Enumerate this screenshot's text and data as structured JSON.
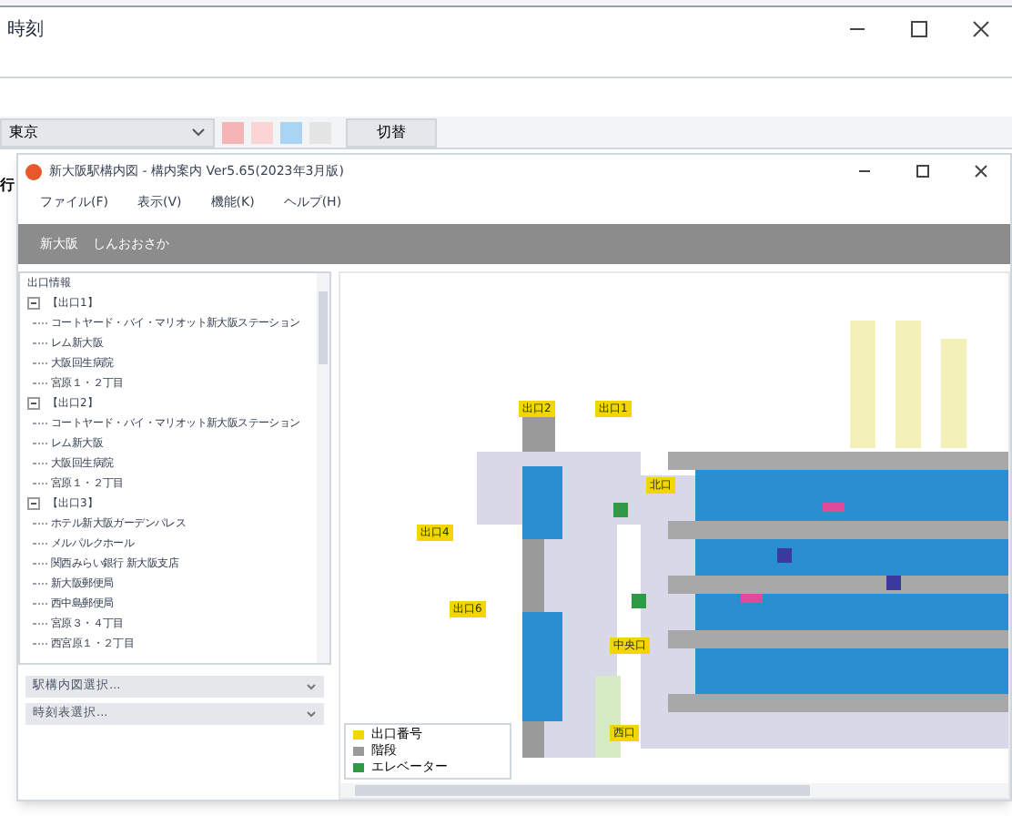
{
  "back_window": {
    "title": "時刻",
    "combo": {
      "value": "東京"
    },
    "switch_button": "切替",
    "left_fragment": "行"
  },
  "window": {
    "title": "新大阪駅構内図 - 構内案内 Ver5.65(2023年3月版)"
  },
  "menu": [
    "ファイル(F)",
    "表示(V)",
    "機能(K)",
    "ヘルプ(H)"
  ],
  "station_bar": {
    "name": "新大阪",
    "reading": "しんおおさか"
  },
  "tree": {
    "header": "出口情報",
    "groups": [
      {
        "label": "【出口1】",
        "expanded": true,
        "children": [
          "コートヤード・バイ・マリオット新大阪ステーション",
          "レム新大阪",
          "大阪回生病院",
          "宮原１・２丁目"
        ]
      },
      {
        "label": "【出口2】",
        "expanded": true,
        "children": [
          "コートヤード・バイ・マリオット新大阪ステーション",
          "レム新大阪",
          "大阪回生病院",
          "宮原１・２丁目"
        ]
      },
      {
        "label": "【出口3】",
        "expanded": true,
        "children": [
          "ホテル新大阪ガーデンパレス",
          "メルパルクホール",
          "関西みらい銀行 新大阪支店",
          "新大阪郵便局",
          "西中島郵便局",
          "宮原３・４丁目",
          "西宮原１・２丁目"
        ]
      }
    ]
  },
  "selects": [
    {
      "placeholder": "駅構内図選択..."
    },
    {
      "placeholder": "時刻表選択..."
    }
  ],
  "map": {
    "labels": [
      "出口2",
      "出口1",
      "北口",
      "出口4",
      "出口6",
      "中央口",
      "西口"
    ],
    "legend": [
      "出口番号",
      "階段",
      "エレベーター"
    ]
  }
}
